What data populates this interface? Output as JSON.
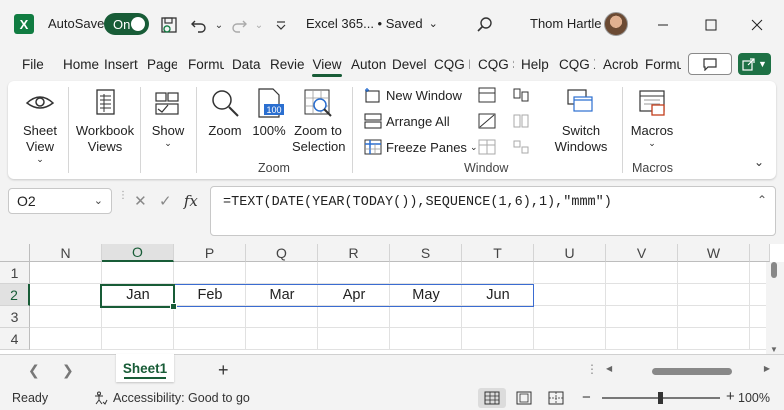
{
  "titlebar": {
    "app_logo": "X",
    "autosave_label": "AutoSave",
    "autosave_state": "On",
    "doc_title": "Excel 365...  • Saved",
    "user_name": "Thom Hartle"
  },
  "tabs": [
    "File",
    "Home",
    "Insert",
    "Page",
    "Formu",
    "Data",
    "Revie",
    "View",
    "Auton",
    "Devel",
    "CQG F",
    "CQG S",
    "Help",
    "CQG X",
    "Acrob",
    "Formu"
  ],
  "active_tab": "View",
  "ribbon": {
    "sheet_view": "Sheet View",
    "workbook_views": "Workbook Views",
    "show": "Show",
    "zoom": "Zoom",
    "zoom_100": "100%",
    "zoom_to_selection": "Zoom to Selection",
    "zoom_group": "Zoom",
    "new_window": "New Window",
    "arrange_all": "Arrange All",
    "freeze_panes": "Freeze Panes",
    "window_group": "Window",
    "switch_windows": "Switch Windows",
    "macros": "Macros",
    "macros_group": "Macros"
  },
  "formula_bar": {
    "name_box": "O2",
    "formula": "=TEXT(DATE(YEAR(TODAY()),SEQUENCE(1,6),1),\"mmm\")"
  },
  "grid": {
    "columns": [
      "N",
      "O",
      "P",
      "Q",
      "R",
      "S",
      "T",
      "U",
      "V",
      "W"
    ],
    "rows": [
      "1",
      "2",
      "3",
      "4"
    ],
    "row2_values": [
      "Jan",
      "Feb",
      "Mar",
      "Apr",
      "May",
      "Jun"
    ]
  },
  "sheets": [
    "Sheet1"
  ],
  "status": {
    "ready": "Ready",
    "accessibility": "Accessibility: Good to go",
    "zoom_level": "100%"
  },
  "colors": {
    "accent": "#185c37",
    "spill_border": "#3b6cd1",
    "logo": "#107c41"
  }
}
